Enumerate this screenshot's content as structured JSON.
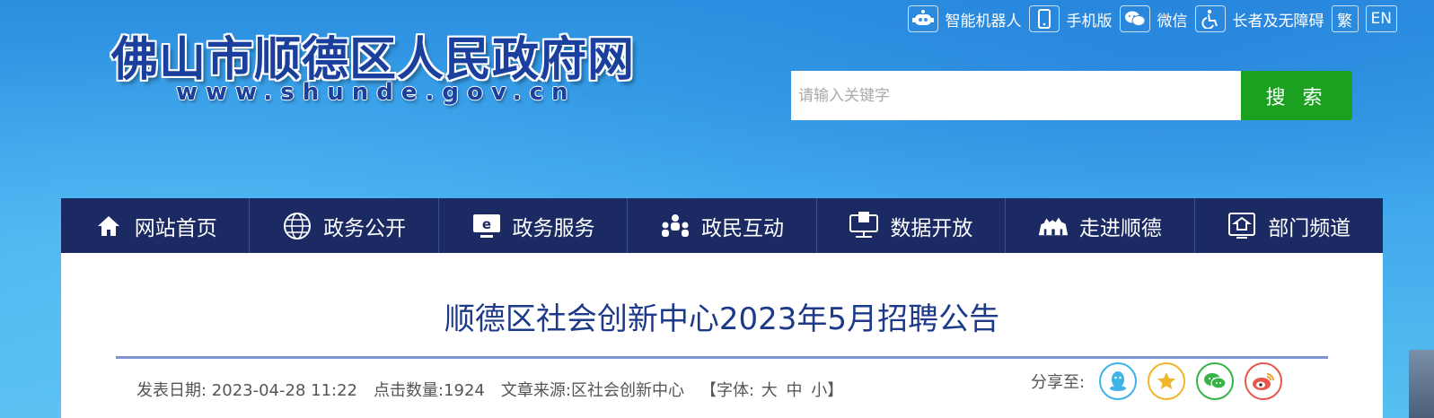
{
  "logo": {
    "title": "佛山市顺德区人民政府网",
    "url": "www.shunde.gov.cn"
  },
  "toplinks": {
    "robot": {
      "label": "智能机器人",
      "icon": "robot-icon"
    },
    "mobile": {
      "label": "手机版",
      "icon": "mobile-phone-icon"
    },
    "wechat": {
      "label": "微信",
      "icon": "wechat-icon"
    },
    "accessible": {
      "label": "长者及无障碍",
      "icon": "wheelchair-icon"
    },
    "traditional": "繁",
    "english": "EN"
  },
  "search": {
    "placeholder": "请输入关键字",
    "button": "搜 索"
  },
  "nav": [
    {
      "label": "网站首页",
      "icon": "home-icon"
    },
    {
      "label": "政务公开",
      "icon": "globe-icon"
    },
    {
      "label": "政务服务",
      "icon": "monitor-e-icon"
    },
    {
      "label": "政民互动",
      "icon": "people-icon"
    },
    {
      "label": "数据开放",
      "icon": "data-screen-icon"
    },
    {
      "label": "走进顺德",
      "icon": "landmark-icon"
    },
    {
      "label": "部门频道",
      "icon": "department-icon"
    }
  ],
  "article": {
    "title": "顺德区社会创新中心2023年5月招聘公告",
    "date": "发表日期: 2023-04-28 11:22",
    "clicks": "点击数量:1924",
    "source": "文章来源:区社会创新中心",
    "font_open": "【字体:",
    "font_large": "大",
    "font_medium": "中",
    "font_small": "小】",
    "share_label": "分享至:"
  },
  "colors": {
    "nav_bg": "#1b2a63",
    "search_button": "#1aa11f",
    "title": "#1d3a8a",
    "qq": "#3db3e8",
    "qzone": "#f0b52a",
    "wechat": "#38b347",
    "weibo": "#e8584a"
  }
}
